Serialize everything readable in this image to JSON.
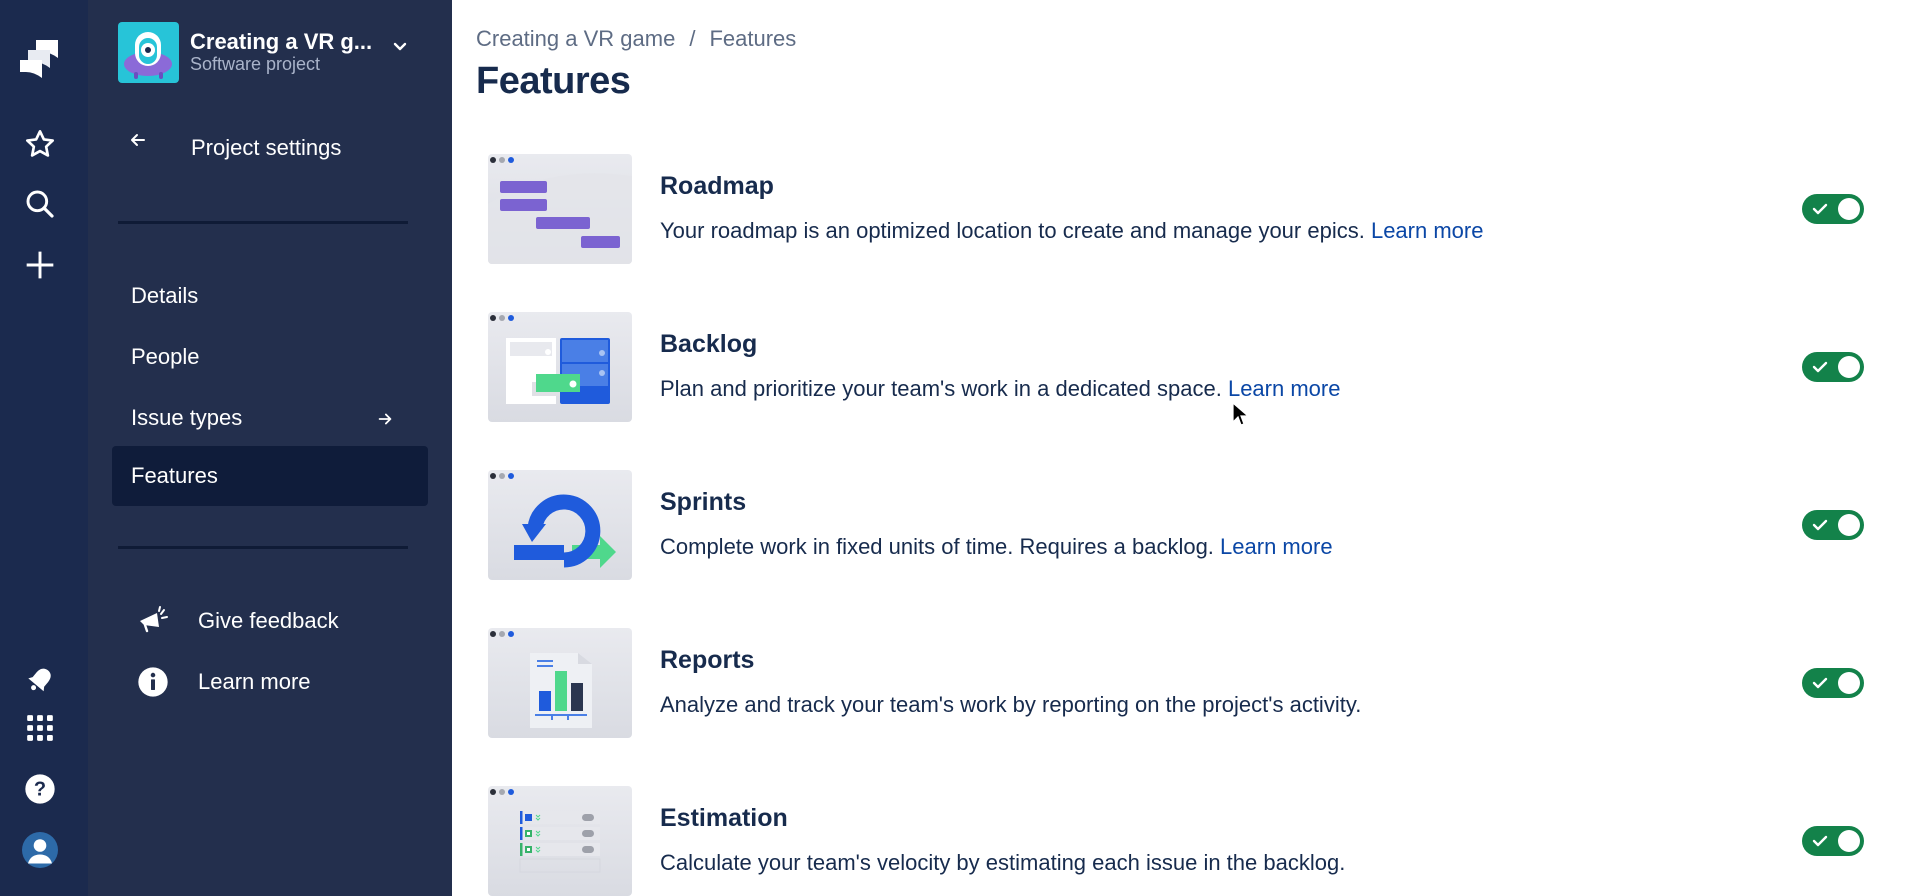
{
  "rail": {
    "icons": [
      "jira-logo-icon",
      "star-icon",
      "search-icon",
      "plus-icon",
      "notification-bell-icon",
      "app-switcher-icon",
      "help-icon",
      "user-avatar-icon"
    ]
  },
  "sidebar": {
    "project_name": "Creating a VR g...",
    "project_type": "Software project",
    "back_label": "Project settings",
    "items": [
      {
        "label": "Details",
        "active": false
      },
      {
        "label": "People",
        "active": false
      },
      {
        "label": "Issue types",
        "active": false,
        "has_arrow": true
      },
      {
        "label": "Features",
        "active": true
      }
    ],
    "footer": [
      {
        "label": "Give feedback",
        "icon": "megaphone-icon"
      },
      {
        "label": "Learn more",
        "icon": "info-icon"
      }
    ]
  },
  "main": {
    "breadcrumb": {
      "project": "Creating a VR game",
      "separator": "/",
      "current": "Features"
    },
    "title": "Features",
    "features": [
      {
        "name": "Roadmap",
        "description": "Your roadmap is an optimized location to create and manage your epics.",
        "link": "Learn more",
        "enabled": true
      },
      {
        "name": "Backlog",
        "description": "Plan and prioritize your team's work in a dedicated space.",
        "link": "Learn more",
        "enabled": true
      },
      {
        "name": "Sprints",
        "description": "Complete work in fixed units of time. Requires a backlog.",
        "link": "Learn more",
        "enabled": true
      },
      {
        "name": "Reports",
        "description": "Analyze and track your team's work by reporting on the project's activity.",
        "link": "",
        "enabled": true
      },
      {
        "name": "Estimation",
        "description": "Calculate your team's velocity by estimating each issue in the backlog.",
        "link": "",
        "enabled": true
      }
    ]
  },
  "colors": {
    "rail_bg": "#1b2a4e",
    "sidebar_bg": "#232f4d",
    "active_item_bg": "#0f1c3a",
    "toggle_on": "#13824a",
    "link": "#0b47a6",
    "text": "#172b4d",
    "muted": "#5e6c84"
  }
}
